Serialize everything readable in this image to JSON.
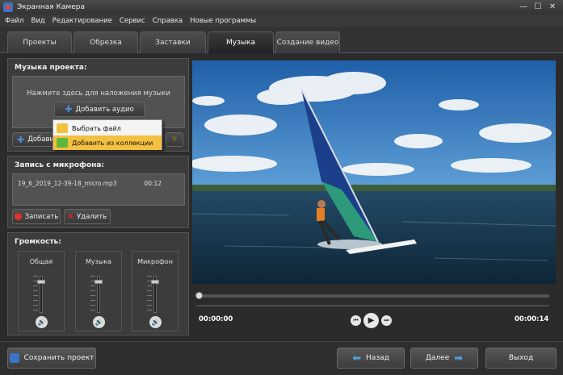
{
  "window": {
    "title": "Экранная Камера"
  },
  "menu": [
    "Файл",
    "Вид",
    "Редактирование",
    "Сервис",
    "Справка",
    "Новые программы"
  ],
  "tabs": [
    {
      "label": "Проекты",
      "active": false
    },
    {
      "label": "Обрезка",
      "active": false
    },
    {
      "label": "Заставки",
      "active": false
    },
    {
      "label": "Музыка",
      "active": true
    },
    {
      "label": "Создание видео",
      "active": false
    }
  ],
  "music": {
    "heading": "Музыка проекта:",
    "hint": "Нажмите здесь для наложения музыки",
    "add_audio_label": "Добавить аудио",
    "add_label_partial": "Добавит",
    "popup": [
      {
        "label": "Выбрать файл",
        "highlighted": false
      },
      {
        "label": "Добавить из коллекции",
        "highlighted": true
      }
    ]
  },
  "mic": {
    "heading": "Запись с микрофона:",
    "file": "19_6_2019_12-39-18_micro.mp3",
    "duration": "00:12",
    "record_label": "Записать",
    "delete_label": "Удалить"
  },
  "volume": {
    "heading": "Громкость:",
    "channels": [
      {
        "label": "Общая",
        "level": 0.9
      },
      {
        "label": "Музыка",
        "level": 0.9
      },
      {
        "label": "Микрофон",
        "level": 0.9
      }
    ]
  },
  "player": {
    "current_time": "00:00:00",
    "total_time": "00:00:14",
    "progress": 0
  },
  "footer": {
    "save_label": "Сохранить проект",
    "back_label": "Назад",
    "next_label": "Далее",
    "exit_label": "Выход"
  },
  "colors": {
    "accent": "#4a90d9",
    "highlight": "#f3c040",
    "record": "#d9342b",
    "delete": "#cc2222"
  }
}
